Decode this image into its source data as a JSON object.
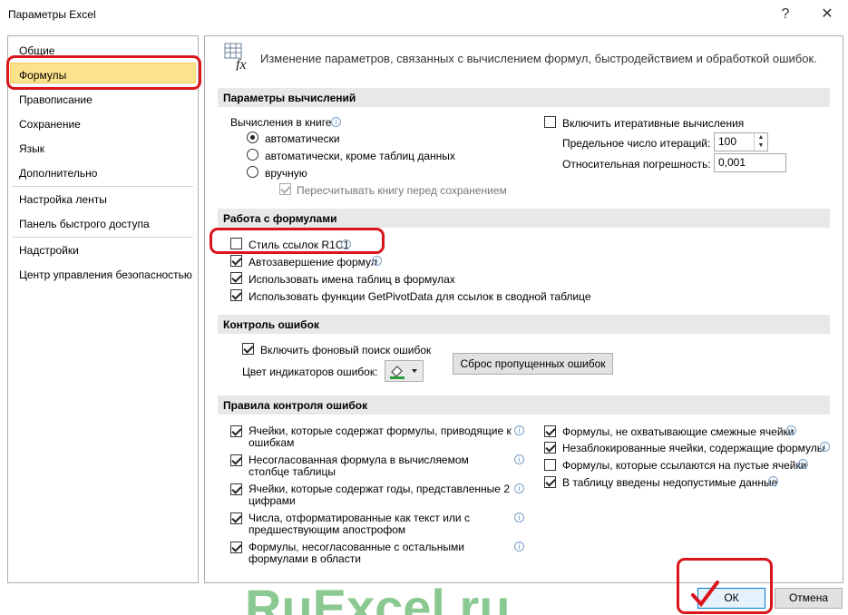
{
  "window": {
    "title": "Параметры Excel",
    "help": "?",
    "close": "✕"
  },
  "sidebar": {
    "items": [
      "Общие",
      "Формулы",
      "Правописание",
      "Сохранение",
      "Язык",
      "Дополнительно",
      "Настройка ленты",
      "Панель быстрого доступа",
      "Надстройки",
      "Центр управления безопасностью"
    ],
    "selected": "Формулы"
  },
  "header": {
    "text": "Изменение параметров, связанных с вычислением формул, быстродействием и обработкой ошибок."
  },
  "calc": {
    "section": "Параметры вычислений",
    "workbook_label": "Вычисления в книге",
    "auto": "автоматически",
    "auto_except": "автоматически, кроме таблиц данных",
    "manual": "вручную",
    "recalc": "Пересчитывать книгу перед сохранением",
    "iterative": "Включить итеративные вычисления",
    "max_iter_label": "Предельное число итераций:",
    "max_iter_value": "100",
    "max_change_label": "Относительная погрешность:",
    "max_change_value": "0,001"
  },
  "formulas": {
    "section": "Работа с формулами",
    "r1c1": "Стиль ссылок R1C1",
    "autocomplete": "Автозавершение формул",
    "table_names": "Использовать имена таблиц в формулах",
    "getpivot": "Использовать функции GetPivotData для ссылок в сводной таблице"
  },
  "errors": {
    "section": "Контроль ошибок",
    "background": "Включить фоновый поиск ошибок",
    "color_label": "Цвет индикаторов ошибок:",
    "reset_button": "Сброс пропущенных ошибок"
  },
  "rules": {
    "section": "Правила контроля ошибок",
    "left": [
      "Ячейки, которые содержат формулы, приводящие к ошибкам",
      "Несогласованная формула в вычисляемом столбце таблицы",
      "Ячейки, которые содержат годы, представленные 2 цифрами",
      "Числа, отформатированные как текст или с предшествующим апострофом",
      "Формулы, несогласованные с остальными формулами в области"
    ],
    "right": [
      "Формулы, не охватывающие смежные ячейки",
      "Незаблокированные ячейки, содержащие формулы",
      "Формулы, которые ссылаются на пустые ячейки",
      "В таблицу введены недопустимые данные"
    ]
  },
  "footer": {
    "ok": "ОК",
    "cancel": "Отмена",
    "watermark": "RuExcel.ru"
  },
  "colors": {
    "selection": "#fde28c",
    "highlight": "#d9141b",
    "watermark": "#2e9e3a"
  }
}
